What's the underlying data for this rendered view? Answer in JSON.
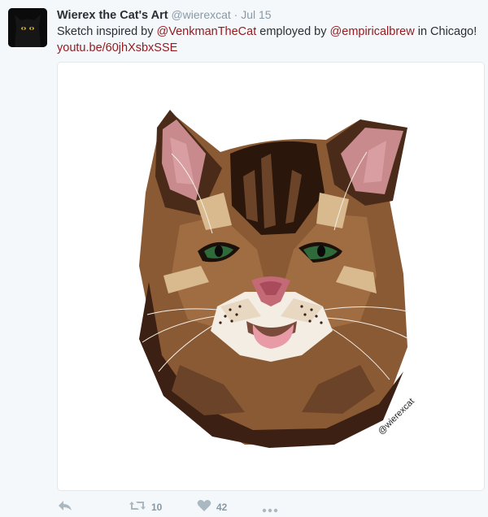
{
  "tweet": {
    "display_name": "Wierex the Cat's Art",
    "handle": "@wierexcat",
    "separator": "·",
    "time": "Jul 15",
    "text_part1": "Sketch inspired by ",
    "mention1": "@VenkmanTheCat",
    "text_part2": " employed by ",
    "mention2": "@empiricalbrew",
    "text_part3": " in Chicago!",
    "link": "youtu.be/60jhXsbxSSE",
    "image_signature": "@wierexcat",
    "retweets": "10",
    "likes": "42"
  },
  "icons": [
    "reply-icon",
    "retweet-icon",
    "heart-icon",
    "more-icon"
  ],
  "colors": {
    "mention": "#94191e",
    "muted": "#8899a6",
    "icon": "#aab8c2",
    "background": "#f5f8fa"
  }
}
